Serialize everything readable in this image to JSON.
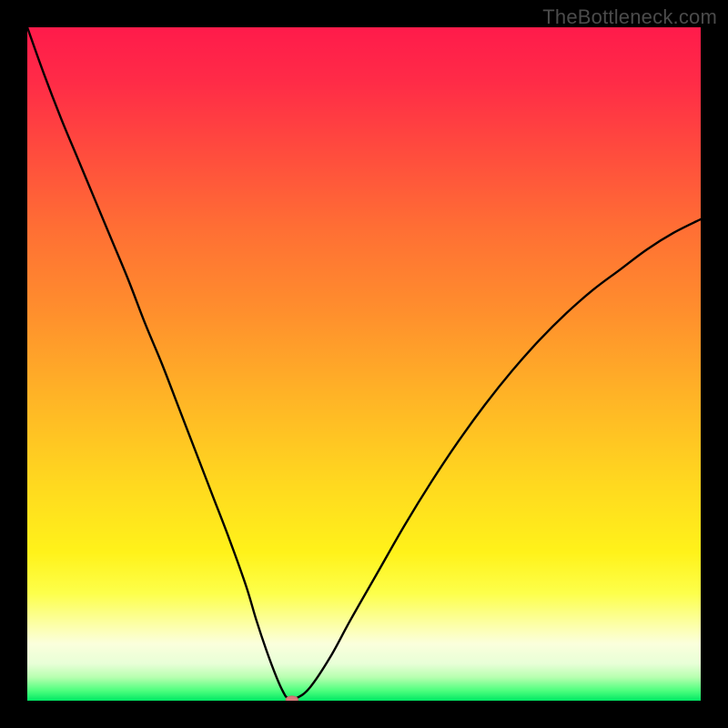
{
  "watermark": "TheBottleneck.com",
  "colors": {
    "frame_bg": "#000000",
    "curve": "#000000",
    "marker_fill": "#d87b7b",
    "marker_stroke": "#c96a6a",
    "gradient_stops": [
      {
        "offset": 0.0,
        "color": "#ff1b4b"
      },
      {
        "offset": 0.08,
        "color": "#ff2b47"
      },
      {
        "offset": 0.18,
        "color": "#ff4a3e"
      },
      {
        "offset": 0.3,
        "color": "#ff6f34"
      },
      {
        "offset": 0.42,
        "color": "#ff8e2d"
      },
      {
        "offset": 0.55,
        "color": "#ffb426"
      },
      {
        "offset": 0.68,
        "color": "#ffd91f"
      },
      {
        "offset": 0.78,
        "color": "#fff21a"
      },
      {
        "offset": 0.84,
        "color": "#fdff4a"
      },
      {
        "offset": 0.885,
        "color": "#fcffa3"
      },
      {
        "offset": 0.915,
        "color": "#fbffdc"
      },
      {
        "offset": 0.945,
        "color": "#e8ffd7"
      },
      {
        "offset": 0.965,
        "color": "#b8ffb0"
      },
      {
        "offset": 0.985,
        "color": "#4eff7e"
      },
      {
        "offset": 1.0,
        "color": "#00e864"
      }
    ]
  },
  "chart_data": {
    "type": "line",
    "title": "",
    "xlabel": "",
    "ylabel": "",
    "xlim": [
      0,
      100
    ],
    "ylim": [
      0,
      100
    ],
    "grid": false,
    "legend": false,
    "annotations": [
      "TheBottleneck.com"
    ],
    "series": [
      {
        "name": "bottleneck-curve",
        "x": [
          0,
          2.5,
          5,
          7.5,
          10,
          12.5,
          15,
          17.5,
          20,
          22.5,
          25,
          27.5,
          30,
          32.5,
          34,
          35.5,
          37,
          38,
          38.7,
          40,
          42,
          45,
          48,
          52,
          56,
          60,
          64,
          68,
          72,
          76,
          80,
          84,
          88,
          92,
          96,
          100
        ],
        "y": [
          100,
          93,
          86.5,
          80.5,
          74.5,
          68.5,
          62.5,
          56,
          50,
          43.5,
          37,
          30.5,
          24,
          17,
          12,
          7.5,
          3.5,
          1.3,
          0.4,
          0.4,
          2,
          6.5,
          12,
          19,
          26,
          32.5,
          38.5,
          44,
          49,
          53.5,
          57.5,
          61,
          64,
          67,
          69.5,
          71.5
        ]
      }
    ],
    "marker": {
      "x": 39.3,
      "y": 0.15,
      "rx": 0.9,
      "ry": 0.55
    }
  }
}
